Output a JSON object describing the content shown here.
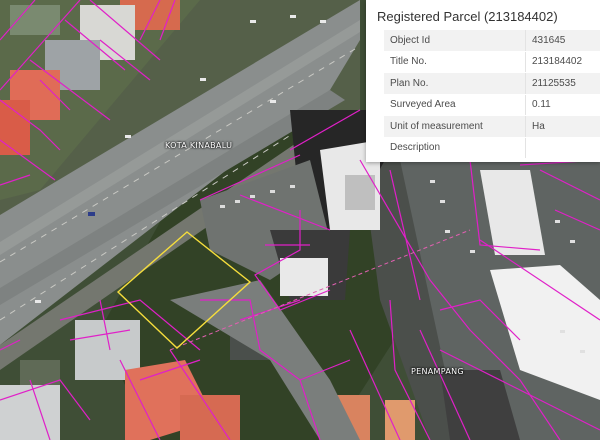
{
  "popup": {
    "title": "Registered Parcel (213184402)",
    "rows": [
      {
        "label": "Object Id",
        "value": "431645"
      },
      {
        "label": "Title No.",
        "value": "213184402"
      },
      {
        "label": "Plan No.",
        "value": "21125535"
      },
      {
        "label": "Surveyed Area",
        "value": "0.11"
      },
      {
        "label": "Unit of measurement",
        "value": "Ha"
      },
      {
        "label": "Description",
        "value": ""
      }
    ]
  },
  "map": {
    "labels": {
      "kota_kinabalu": "KOTA KINABALU",
      "penampang": "PENAMPANG"
    },
    "colors": {
      "parcel_boundary": "#e020c8",
      "selected_parcel": "#f5dd3c",
      "road_line": "#e060b0"
    }
  }
}
